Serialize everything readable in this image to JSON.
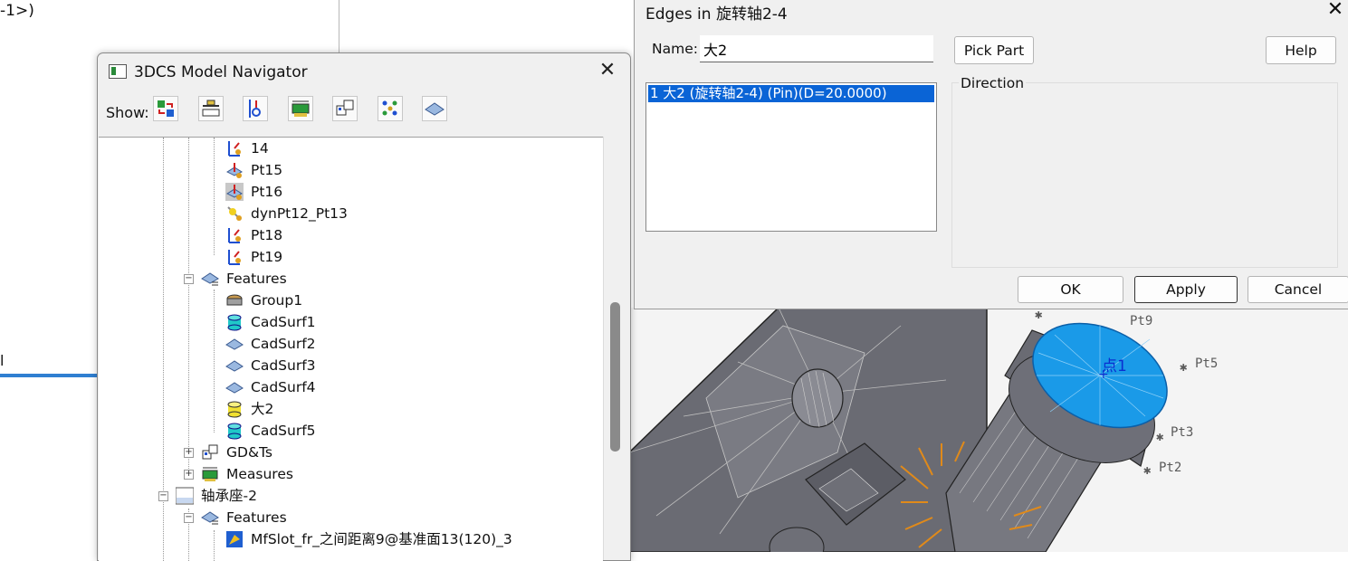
{
  "background": {
    "text_fragment": "-1>)",
    "tick_fragment": "l"
  },
  "navigator": {
    "title": "3DCS Model Navigator",
    "close_glyph": "✕",
    "show_label": "Show:",
    "toolbar_icons": [
      "moves-icon",
      "tolerances-icon",
      "points-icon",
      "measures-icon",
      "gdt-icon",
      "points-grid-icon",
      "features-icon"
    ],
    "tree": [
      {
        "label": "14",
        "icon": "point-move-icon"
      },
      {
        "label": "Pt15",
        "icon": "point-icon"
      },
      {
        "label": "Pt16",
        "icon": "point-icon-selected"
      },
      {
        "label": "dynPt12_Pt13",
        "icon": "dynamic-point-icon"
      },
      {
        "label": "Pt18",
        "icon": "point-move-icon"
      },
      {
        "label": "Pt19",
        "icon": "point-move-icon"
      },
      {
        "label": "Features",
        "icon": "features-icon"
      },
      {
        "label": "Group1",
        "icon": "group-icon"
      },
      {
        "label": "CadSurf1",
        "icon": "cylinder-icon"
      },
      {
        "label": "CadSurf2",
        "icon": "surface-icon"
      },
      {
        "label": "CadSurf3",
        "icon": "surface-icon"
      },
      {
        "label": "CadSurf4",
        "icon": "surface-icon"
      },
      {
        "label": "大2",
        "icon": "cylinder-yellow-icon"
      },
      {
        "label": "CadSurf5",
        "icon": "cylinder-icon"
      },
      {
        "label": "GD&Ts",
        "icon": "gdt-icon"
      },
      {
        "label": "Measures",
        "icon": "measures-icon"
      },
      {
        "label": "轴承座-2",
        "icon": "part-icon"
      },
      {
        "label": "Features",
        "icon": "features-icon"
      },
      {
        "label": "MfSlot_fr_之间距离9@基准面13(120)_3",
        "icon": "slot-icon"
      }
    ]
  },
  "dialog": {
    "title": "Edges in 旋转轴2-4",
    "close_glyph": "✕",
    "name_label": "Name:",
    "name_value": "大2",
    "list_items": [
      "1 大2 (旋转轴2-4) (Pin)(D=20.0000)"
    ],
    "pick_part_label": "Pick Part",
    "help_label": "Help",
    "direction_label": "Direction",
    "ok_label": "OK",
    "apply_label": "Apply",
    "cancel_label": "Cancel"
  },
  "viewport": {
    "point_labels": [
      "Pt9",
      "Pt5",
      "Pt3",
      "Pt2",
      "点1"
    ],
    "colors": {
      "face": "#1a9ae8",
      "body": "#6e6f78",
      "arrows": "#e08a1a"
    }
  }
}
